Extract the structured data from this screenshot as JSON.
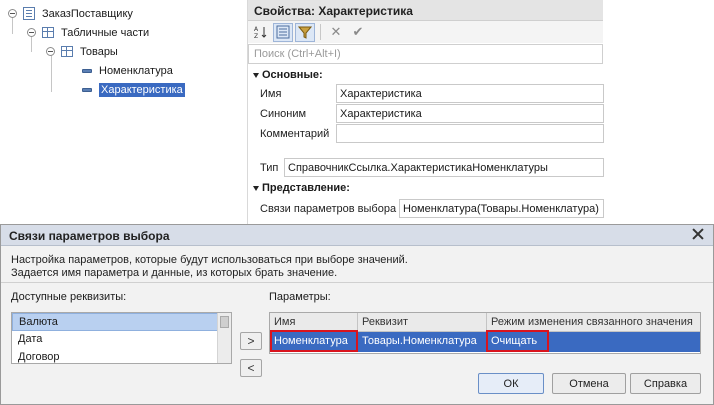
{
  "tree": {
    "items": [
      {
        "label": "ЗаказПоставщику"
      },
      {
        "label": "Табличные части"
      },
      {
        "label": "Товары"
      },
      {
        "label": "Номенклатура"
      },
      {
        "label": "Характеристика"
      }
    ]
  },
  "props": {
    "title": "Свойства: Характеристика",
    "search_placeholder": "Поиск (Ctrl+Alt+I)",
    "section_main": "Основные:",
    "name_label": "Имя",
    "name_value": "Характеристика",
    "synonym_label": "Синоним",
    "synonym_value": "Характеристика",
    "comment_label": "Комментарий",
    "comment_value": "",
    "type_label": "Тип",
    "type_value": "СправочникСсылка.ХарактеристикаНоменклатуры",
    "section_view": "Представление:",
    "links_label": "Связи параметров выбора",
    "links_value": "Номенклатура(Товары.Номенклатура)"
  },
  "dialog": {
    "title": "Связи параметров выбора",
    "desc_line1": "Настройка параметров, которые будут использоваться при выборе значений.",
    "desc_line2": "Задается имя параметра и данные, из которых брать значение.",
    "available_label": "Доступные реквизиты:",
    "available_items": [
      "Валюта",
      "Дата",
      "Договор"
    ],
    "add_button": ">",
    "remove_button": "<",
    "params_label": "Параметры:",
    "columns": [
      "Имя",
      "Реквизит",
      "Режим изменения связанного значения"
    ],
    "rows": [
      {
        "name": "Номенклатура",
        "attr": "Товары.Номенклатура",
        "mode": "Очищать"
      }
    ],
    "ok": "ОК",
    "cancel": "Отмена",
    "help": "Справка"
  },
  "colors": {
    "selection": "#3a6ac1",
    "highlight_box": "#d9141d",
    "dialog_title_bg": "#d7dde8"
  }
}
